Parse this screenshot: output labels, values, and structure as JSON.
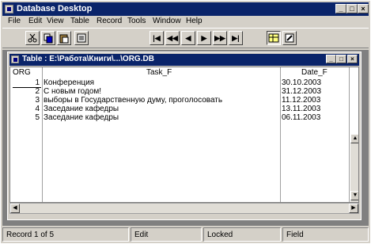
{
  "app": {
    "title": "Database Desktop",
    "window_controls": {
      "minimize": "_",
      "maximize": "□",
      "close": "×"
    }
  },
  "menu": [
    "File",
    "Edit",
    "View",
    "Table",
    "Record",
    "Tools",
    "Window",
    "Help"
  ],
  "toolbar": {
    "cut_icon": "scissors-icon",
    "copy_icon": "copy-icon",
    "paste_icon": "paste-icon",
    "print_icon": "print-icon",
    "nav_first": "|◀",
    "nav_prev_set": "◀◀",
    "nav_prev": "◀",
    "nav_next": "▶",
    "nav_next_set": "▶▶",
    "nav_last": "▶|"
  },
  "table_window": {
    "title": "Table : E:\\Работа\\Книги\\...\\ORG.DB",
    "controls": {
      "minimize": "_",
      "maximize": "□",
      "close": "×"
    },
    "columns": [
      "ORG",
      "Task_F",
      "Date_F"
    ],
    "rows": [
      {
        "org": "1",
        "task": "Конференция",
        "date": "30.10.2003"
      },
      {
        "org": "2",
        "task": "С новым годом!",
        "date": "31.12.2003"
      },
      {
        "org": "3",
        "task": "выборы в Государственную думу, проголосовать",
        "date": "11.12.2003"
      },
      {
        "org": "4",
        "task": "Заседание кафедры",
        "date": "13.11.2003"
      },
      {
        "org": "5",
        "task": "Заседание кафедры",
        "date": "06.11.2003"
      }
    ]
  },
  "status": {
    "record": "Record 1 of 5",
    "mode": "Edit",
    "lock": "Locked",
    "field": "Field"
  }
}
